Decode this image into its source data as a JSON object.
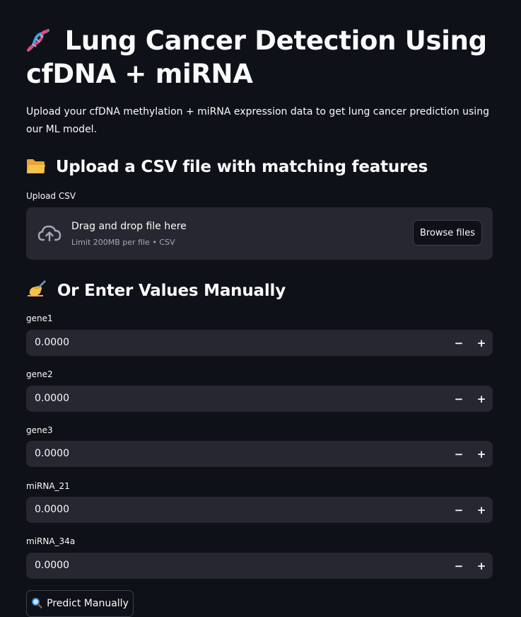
{
  "header": {
    "icon": "dna-icon",
    "title": "Lung Cancer Detection Using cfDNA + miRNA",
    "description": "Upload your cfDNA methylation + miRNA expression data to get lung cancer prediction using our ML model."
  },
  "upload_section": {
    "icon": "folder-icon",
    "heading": "Upload a CSV file with matching features",
    "field_label": "Upload CSV",
    "drop_text": "Drag and drop file here",
    "limit_text": "Limit 200MB per file • CSV",
    "browse_label": "Browse files"
  },
  "manual_section": {
    "icon": "writing-hand-icon",
    "heading": "Or Enter Values Manually",
    "fields": [
      {
        "label": "gene1",
        "value": "0.0000"
      },
      {
        "label": "gene2",
        "value": "0.0000"
      },
      {
        "label": "gene3",
        "value": "0.0000"
      },
      {
        "label": "miRNA_21",
        "value": "0.0000"
      },
      {
        "label": "miRNA_34a",
        "value": "0.0000"
      }
    ],
    "stepper_minus": "−",
    "stepper_plus": "+",
    "predict_icon": "magnifier-icon",
    "predict_label": "Predict Manually"
  },
  "colors": {
    "background": "#0e1117",
    "widget": "#262730",
    "text": "#fafafa",
    "muted": "#a3a8b8"
  }
}
